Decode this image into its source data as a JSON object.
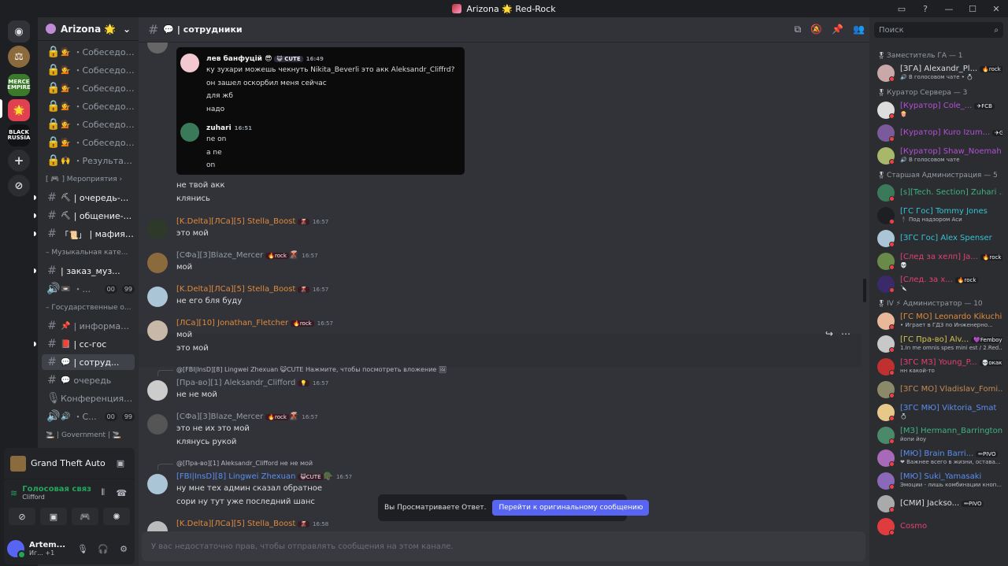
{
  "window": {
    "title": "Arizona 🌟 Red-Rock",
    "controls": [
      "▭",
      "?",
      "—",
      "☐",
      "✕"
    ]
  },
  "servers": [
    {
      "label": "",
      "color": "#5865f2",
      "glyph": "◉"
    },
    {
      "label": "",
      "color": "#8b6a3e",
      "glyph": "⚖"
    },
    {
      "label": "MERCE EMPIRE",
      "color": "#3a7a2a",
      "glyph": ""
    },
    {
      "label": "",
      "color": "#e04050",
      "glyph": "🌟"
    },
    {
      "label": "BLACK RUSSIA",
      "color": "#111214",
      "glyph": ""
    },
    {
      "label": "",
      "color": "#2b2d31",
      "glyph": "+"
    },
    {
      "label": "",
      "color": "#2b2d31",
      "glyph": "⊘"
    }
  ],
  "guild": {
    "name": "Arizona 🌟 Re...",
    "chevron": "⌄"
  },
  "channels": [
    {
      "icon": "🔒",
      "emoji": "💁",
      "label": "・Собеседов...",
      "state": ""
    },
    {
      "icon": "🔒",
      "emoji": "💁",
      "label": "・Собеседов...",
      "state": ""
    },
    {
      "icon": "🔒",
      "emoji": "💁",
      "label": "・Собеседов...",
      "state": ""
    },
    {
      "icon": "🔒",
      "emoji": "💁",
      "label": "・Собеседов...",
      "state": ""
    },
    {
      "icon": "🔒",
      "emoji": "💁",
      "label": "・Собеседов...",
      "state": ""
    },
    {
      "icon": "🔒",
      "emoji": "💁",
      "label": "・Собеседов...",
      "state": ""
    },
    {
      "icon": "🔒",
      "emoji": "🙌",
      "label": "・Результат...",
      "state": ""
    },
    {
      "cat": "[ 🎮 ] Мероприятия ›"
    },
    {
      "icon": "#",
      "emoji": "⛏",
      "label": "| очередь-...",
      "state": "unread"
    },
    {
      "icon": "#",
      "emoji": "⛏",
      "label": "| общение-...",
      "state": "unread"
    },
    {
      "icon": "#",
      "emoji": "「📜」",
      "label": "| мафия-...",
      "state": "unread"
    },
    {
      "cat": "– Музыкальная кате..."
    },
    {
      "icon": "#",
      "emoji": "",
      "label": "| заказ_муз...",
      "state": "unread"
    },
    {
      "icon": "🔊",
      "emoji": "📼",
      "label": "・...",
      "state": "",
      "badges": [
        "00",
        "99"
      ]
    },
    {
      "cat": "– Государственные о..."
    },
    {
      "icon": "#",
      "emoji": "📌",
      "label": "| информац...",
      "state": ""
    },
    {
      "icon": "#",
      "emoji": "📕",
      "label": "| cc-гос",
      "state": "unread"
    },
    {
      "icon": "#",
      "emoji": "💬",
      "label": "| сотруд...",
      "state": "sel"
    },
    {
      "icon": "#",
      "emoji": "💬",
      "label": "очередь",
      "state": ""
    },
    {
      "icon": "🎙",
      "emoji": "",
      "label": "Конференция с...",
      "state": ""
    },
    {
      "icon": "🔊",
      "emoji": "🔊",
      "label": "・С...",
      "state": "",
      "badges": [
        "00",
        "99"
      ]
    },
    {
      "cat": "🚬 | Government | 🚬"
    }
  ],
  "voice": {
    "game": "Grand Theft Auto S...",
    "status": "Голосовая связ",
    "server": "Clifford",
    "user": {
      "name": "Artem...",
      "status": "Иг...",
      "extra": "+1"
    }
  },
  "channel_header": {
    "name": "💬 | сотрудники"
  },
  "messages": [
    {
      "kind": "embed",
      "lines": [
        {
          "author": "лев банфуцій 😎",
          "tag": "😺 CUTE",
          "time": "16:49"
        },
        {
          "text": "ку зухари можешь чекнуть Nikita_Beverli это акк Aleksandr_Cliffrd?"
        },
        {
          "text": "он зашел оскорбил меня сейчас"
        },
        {
          "text": "для жб"
        },
        {
          "text": "надо"
        },
        {
          "author": "zuhari",
          "time": "16:51"
        },
        {
          "text": "ne on"
        },
        {
          "text": "a ne"
        },
        {
          "text": "on"
        }
      ]
    },
    {
      "kind": "cont",
      "text": "не твой акк"
    },
    {
      "kind": "cont",
      "text": "клянись"
    },
    {
      "kind": "msg",
      "author": "[K.Delta][ЛСа][5] Stella_Boost",
      "color": "#e08a3c",
      "tag": "🌋",
      "time": "16:57",
      "text": "это мой"
    },
    {
      "kind": "msg",
      "author": "[СФа][3]Blaze_Mercer",
      "color": "#949ba4",
      "tag": "🔥rock",
      "tag2": "🌋",
      "time": "16:57",
      "text": "мой"
    },
    {
      "kind": "msg",
      "author": "[K.Delta][ЛСа][5] Stella_Boost",
      "color": "#e08a3c",
      "tag": "🌋",
      "time": "16:57",
      "text": "не его бля буду"
    },
    {
      "kind": "msg",
      "author": "[ЛСа][10] Jonathan_Fletcher",
      "color": "#e08a3c",
      "tag": "🔥rock",
      "time": "16:57",
      "text": "мой",
      "text2": "это мой"
    },
    {
      "kind": "reply",
      "reply": "@[FBI|InsD][8] Lingwei Zhexuan 😺CUTE Нажмите, чтобы посмотреть вложение 🖼",
      "author": "[Пра-во][1] Aleksandr_Clifford",
      "color": "#949ba4",
      "tag": "💡",
      "time": "16:57",
      "text": "не не мой"
    },
    {
      "kind": "msg",
      "author": "[СФа][3]Blaze_Mercer",
      "color": "#949ba4",
      "tag": "🔥rock",
      "tag2": "🌋",
      "time": "16:57",
      "text": "это не их это мой",
      "text2": "клянусь рукой"
    },
    {
      "kind": "reply",
      "reply": "@[Пра-во][1] Aleksandr_Clifford  не не мой",
      "author": "[FBI|InsD][8] Lingwei Zhexuan",
      "color": "#5b8ef0",
      "tag": "😺CUTE",
      "tag2": "🪖",
      "time": "16:57",
      "text": "ну мне тех админ сказал обратное",
      "text2": "сори ну тут уже последний шанс"
    },
    {
      "kind": "msg",
      "author": "[K.Delta][ЛСа][5] Stella_Boost",
      "color": "#e08a3c",
      "tag": "🌋",
      "time": "16:58",
      "text": ""
    }
  ],
  "toast": {
    "text": "Вы Просматриваете Ответ.",
    "button": "Перейти к оригинальному сообщению"
  },
  "composer": {
    "placeholder": "У вас недостаточно прав, чтобы отправлять сообщения на этом канале."
  },
  "search": {
    "placeholder": "Поиск"
  },
  "member_groups": [
    {
      "title": "Заместитель ГА — 1",
      "members": [
        {
          "name": "[ЗГА] Alexandr_Pl...",
          "color": "#dbdee1",
          "tag": "🔥rock",
          "sub": "🔊 В голосовом чате • 💍"
        }
      ]
    },
    {
      "title": "Куратор Сервера — 3",
      "members": [
        {
          "name": "[Куратор] Cole_...",
          "color": "#b44fd6",
          "tag": "✈FCB",
          "sub": "🍿"
        },
        {
          "name": "[Куратор] Kuro Izum...",
          "color": "#b44fd6",
          "tag": "✈GI",
          "sub": ""
        },
        {
          "name": "[Куратор] Shaw_Noemah",
          "color": "#b44fd6",
          "tag": "",
          "sub": "🔊 В голосовом чате"
        }
      ]
    },
    {
      "title": "Старшая Администрация — 5",
      "members": [
        {
          "name": "[s][Tech. Section] Zuhari ...",
          "color": "#3fb37f",
          "tag": "",
          "sub": ""
        },
        {
          "name": "[ГС Гос] Tommy Jones",
          "color": "#35c3d6",
          "tag": "",
          "sub": "🕴 Под надзором Аси"
        },
        {
          "name": "[ЗГС Гос] Alex Spenser",
          "color": "#35c3d6",
          "tag": "",
          "sub": ""
        },
        {
          "name": "[След за хелп] Ja...",
          "color": "#e5416f",
          "tag": "🔥rock",
          "sub": "💀"
        },
        {
          "name": "[След. за х...",
          "color": "#e5416f",
          "tag": "🔥rock",
          "sub": "🔪"
        }
      ]
    },
    {
      "title": "IV ⚡ Администратор — 10",
      "members": [
        {
          "name": "[ГС МО] Leonardo Kikuchi",
          "color": "#e08a3c",
          "tag": "",
          "sub": "• Играет в ГДЗ по Инженерно..."
        },
        {
          "name": "[ГС Пра-во] Alv...",
          "color": "#d6c24f",
          "tag": "💜Femboy",
          "sub": "1.In me omnis spes mini est / 2.Red..."
        },
        {
          "name": "[ЗГС МЗ] Young_P...",
          "color": "#e5416f",
          "tag": "💀окак",
          "sub": "нн какой-то"
        },
        {
          "name": "[ЗГС МО] Vladislav_Fomi...",
          "color": "#c68a4f",
          "tag": "",
          "sub": ""
        },
        {
          "name": "[ЗГС МЮ] Viktoria_Smat",
          "color": "#5b8ef0",
          "tag": "",
          "sub": "💍"
        },
        {
          "name": "[МЗ] Hermann_Barrington",
          "color": "#3fb37f",
          "tag": "",
          "sub": "йопи йоу"
        },
        {
          "name": "[МЮ] Brain Barri...",
          "color": "#5b8ef0",
          "tag": "✏PIVO",
          "sub": "❤ Важнее всего в жизни, остава..."
        },
        {
          "name": "[МЮ] Suki_Yamasaki",
          "color": "#5b8ef0",
          "tag": "",
          "sub": "Эмоции - лишь комбинации кноп..."
        },
        {
          "name": "[СМИ] Jackso...",
          "color": "#dbdee1",
          "tag": "✏PIVO",
          "sub": ""
        },
        {
          "name": "Cosmo",
          "color": "#e5416f",
          "tag": "",
          "sub": ""
        }
      ]
    }
  ]
}
